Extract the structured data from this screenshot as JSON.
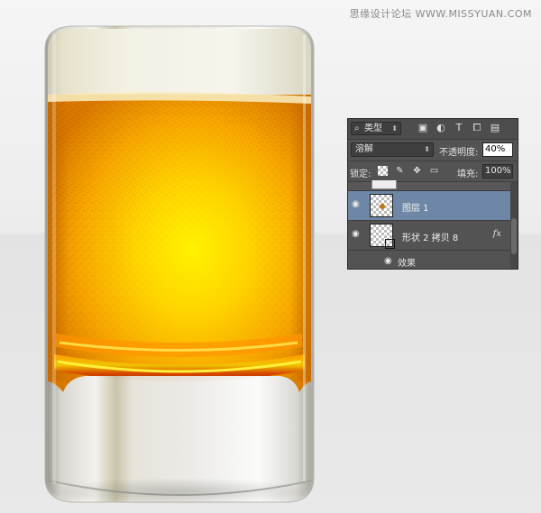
{
  "watermark": "思缘设计论坛 WWW.MISSYUAN.COM",
  "colors": {
    "beer_center": "#fff200",
    "beer_edge": "#e08a00",
    "foam": "#f1eee0",
    "glass_body": "#e8e7e2",
    "panel_bg": "#535353",
    "selected_layer": "#6e87a6"
  },
  "layers_panel": {
    "filter": {
      "label": "类型",
      "icon": "search-icon"
    },
    "filter_icons": [
      "image-filter-icon",
      "adjustment-filter-icon",
      "type-filter-icon",
      "shape-filter-icon",
      "smart-object-filter-icon"
    ],
    "blend_mode": "溶解",
    "opacity_label": "不透明度:",
    "opacity_value": "40%",
    "lock_label": "锁定:",
    "fill_label": "填充:",
    "fill_value": "100%",
    "layers": [
      {
        "name": "图层 1",
        "selected": true
      },
      {
        "name": "形状 2 拷贝 8",
        "fx": "fx",
        "selected": false
      }
    ],
    "effects_label": "效果"
  }
}
